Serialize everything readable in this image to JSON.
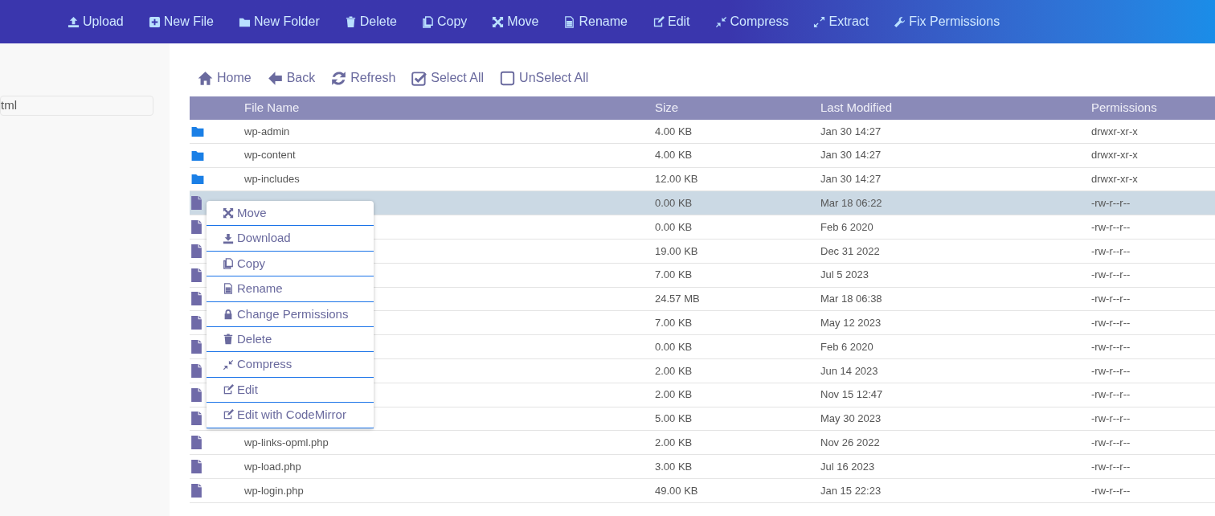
{
  "top_toolbar": [
    {
      "label": "Upload"
    },
    {
      "label": "New File"
    },
    {
      "label": "New Folder"
    },
    {
      "label": "Delete"
    },
    {
      "label": "Copy"
    },
    {
      "label": "Move"
    },
    {
      "label": "Rename"
    },
    {
      "label": "Edit"
    },
    {
      "label": "Compress"
    },
    {
      "label": "Extract"
    },
    {
      "label": "Fix Permissions"
    }
  ],
  "sidebar": {
    "path_field": "tml"
  },
  "nav_toolbar": [
    {
      "label": "Home"
    },
    {
      "label": "Back"
    },
    {
      "label": "Refresh"
    },
    {
      "label": "Select All"
    },
    {
      "label": "UnSelect All"
    }
  ],
  "table": {
    "columns": [
      "File Name",
      "Size",
      "Last Modified",
      "Permissions"
    ],
    "rows": [
      {
        "kind": "folder",
        "name": "wp-admin",
        "size": "4.00 KB",
        "modified": "Jan 30 14:27",
        "permissions": "drwxr-xr-x",
        "selected": false
      },
      {
        "kind": "folder",
        "name": "wp-content",
        "size": "4.00 KB",
        "modified": "Jan 30 14:27",
        "permissions": "drwxr-xr-x",
        "selected": false
      },
      {
        "kind": "folder",
        "name": "wp-includes",
        "size": "12.00 KB",
        "modified": "Jan 30 14:27",
        "permissions": "drwxr-xr-x",
        "selected": false
      },
      {
        "kind": "file",
        "size": "0.00 KB",
        "modified": "Mar 18 06:22",
        "permissions": "-rw-r--r--",
        "selected": true
      },
      {
        "kind": "file",
        "size": "0.00 KB",
        "modified": "Feb 6 2020",
        "permissions": "-rw-r--r--",
        "selected": false
      },
      {
        "kind": "file",
        "size": "19.00 KB",
        "modified": "Dec 31 2022",
        "permissions": "-rw-r--r--",
        "selected": false
      },
      {
        "kind": "file",
        "size": "7.00 KB",
        "modified": "Jul 5 2023",
        "permissions": "-rw-r--r--",
        "selected": false
      },
      {
        "kind": "file",
        "size": "24.57 MB",
        "modified": "Mar 18 06:38",
        "permissions": "-rw-r--r--",
        "selected": false
      },
      {
        "kind": "file",
        "size": "7.00 KB",
        "modified": "May 12 2023",
        "permissions": "-rw-r--r--",
        "selected": false
      },
      {
        "kind": "file",
        "size": "0.00 KB",
        "modified": "Feb 6 2020",
        "permissions": "-rw-r--r--",
        "selected": false
      },
      {
        "kind": "file",
        "size": "2.00 KB",
        "modified": "Jun 14 2023",
        "permissions": "-rw-r--r--",
        "selected": false
      },
      {
        "kind": "file",
        "size": "2.00 KB",
        "modified": "Nov 15 12:47",
        "permissions": "-rw-r--r--",
        "selected": false
      },
      {
        "kind": "file",
        "size": "5.00 KB",
        "modified": "May 30 2023",
        "permissions": "-rw-r--r--",
        "selected": false
      },
      {
        "kind": "file",
        "name": "wp-links-opml.php",
        "size": "2.00 KB",
        "modified": "Nov 26 2022",
        "permissions": "-rw-r--r--",
        "selected": false
      },
      {
        "kind": "file",
        "name": "wp-load.php",
        "size": "3.00 KB",
        "modified": "Jul 16 2023",
        "permissions": "-rw-r--r--",
        "selected": false
      },
      {
        "kind": "file",
        "name": "wp-login.php",
        "size": "49.00 KB",
        "modified": "Jan 15 22:23",
        "permissions": "-rw-r--r--",
        "selected": false
      }
    ]
  },
  "context_menu": [
    {
      "label": "Move"
    },
    {
      "label": "Download"
    },
    {
      "label": "Copy"
    },
    {
      "label": "Rename"
    },
    {
      "label": "Change Permissions"
    },
    {
      "label": "Delete"
    },
    {
      "label": "Compress"
    },
    {
      "label": "Edit"
    },
    {
      "label": "Edit with CodeMirror"
    }
  ]
}
